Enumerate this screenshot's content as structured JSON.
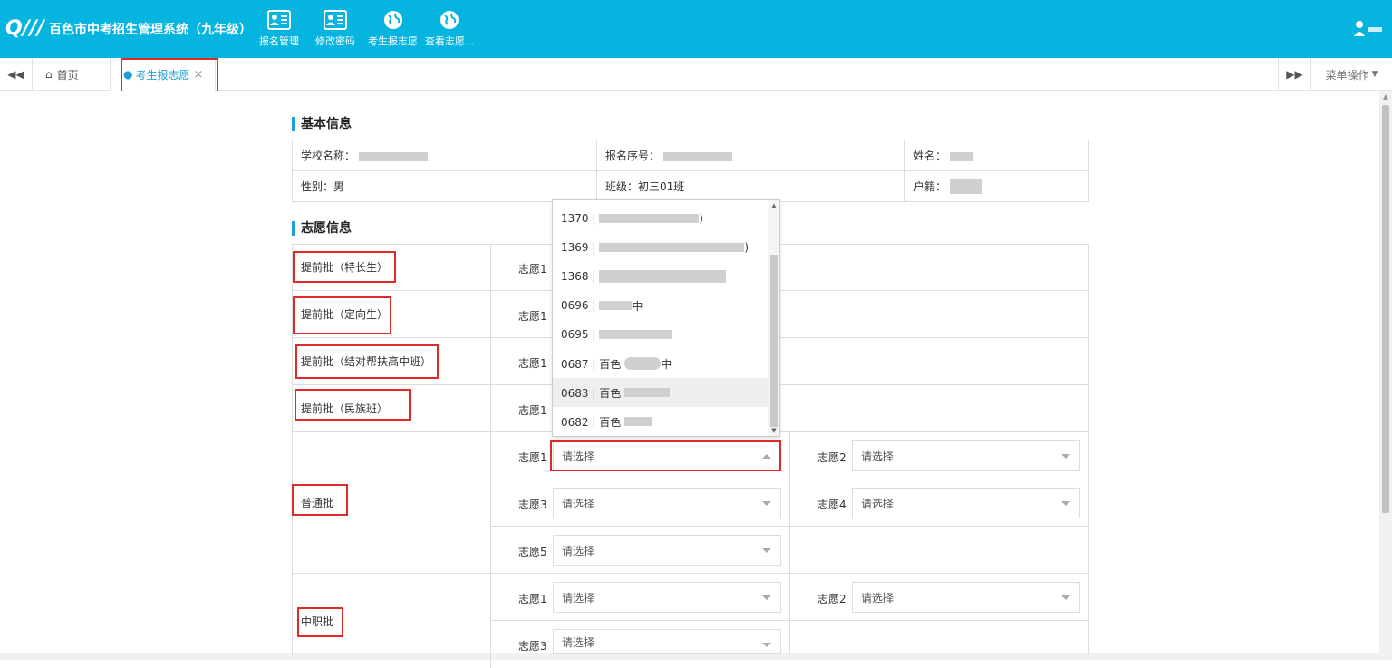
{
  "header": {
    "logo_text": "Q///",
    "app_title": "百色市中考招生管理系统（九年级）",
    "nav": [
      {
        "label": "报名管理",
        "icon": "id-card-icon"
      },
      {
        "label": "修改密码",
        "icon": "id-card-icon"
      },
      {
        "label": "考生报志愿",
        "icon": "globe-icon"
      },
      {
        "label": "查看志愿...",
        "icon": "globe-icon"
      }
    ],
    "user_icon": "user-icon"
  },
  "tabs": {
    "prev_icon": "double-left-icon",
    "home_label": "首页",
    "active_label": "考生报志愿",
    "close_glyph": "×",
    "next_icon": "double-right-icon",
    "menu_label": "菜单操作"
  },
  "basic_info": {
    "title": "基本信息",
    "school_label": "学校名称：",
    "reg_no_label": "报名序号：",
    "name_label": "姓名：",
    "gender": "性别：男",
    "class": "班级：初三01班",
    "household_label": "户籍："
  },
  "wish_info": {
    "title": "志愿信息",
    "batches": [
      {
        "label": "提前批（特长生）"
      },
      {
        "label": "提前批（定向生）"
      },
      {
        "label": "提前批（结对帮扶高中班）"
      },
      {
        "label": "提前批（民族班）"
      },
      {
        "label": "普通批"
      },
      {
        "label": "中职批"
      }
    ],
    "wish_labels": [
      "志愿1",
      "志愿2",
      "志愿3",
      "志愿4",
      "志愿5"
    ],
    "placeholder": "请选择"
  },
  "dropdown": {
    "items": [
      {
        "code": "1370 |",
        "suffix": ")"
      },
      {
        "code": "1369 |",
        "suffix": ")"
      },
      {
        "code": "1368 |",
        "suffix": ""
      },
      {
        "code": "0696 |",
        "suffix": "中"
      },
      {
        "code": "0695 |",
        "suffix": ""
      },
      {
        "code": "0687 | 百色",
        "suffix": "中"
      },
      {
        "code": "0683 | 百色",
        "suffix": ""
      },
      {
        "code": "0682 | 百色",
        "suffix": ""
      }
    ]
  },
  "colors": {
    "header": "#05b5e0",
    "accent": "#1d9fd8",
    "highlight_box": "#e02a2a"
  }
}
